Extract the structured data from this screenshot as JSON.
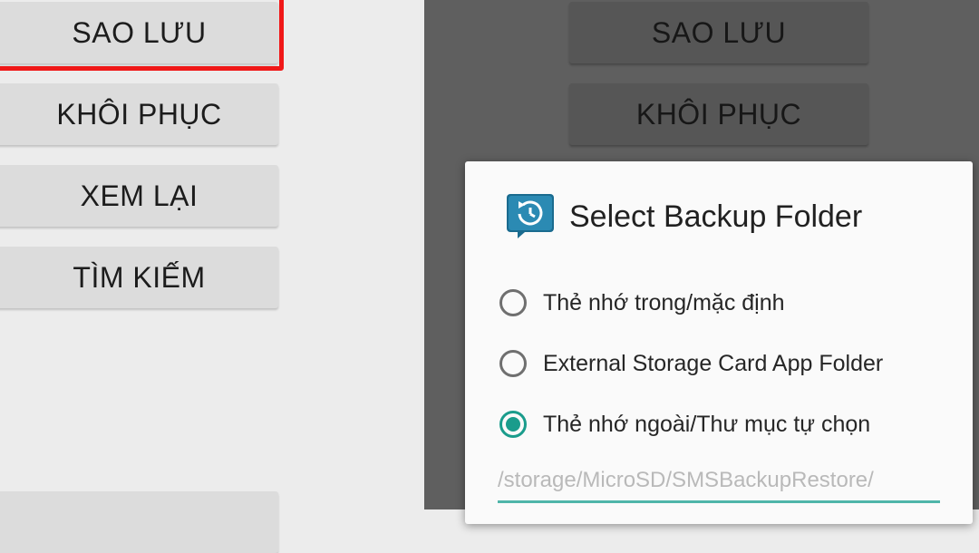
{
  "left_menu": {
    "backup_label": "SAO LƯU",
    "restore_label": "KHÔI PHỤC",
    "view_label": "XEM LẠI",
    "search_label": "TÌM KIẾM"
  },
  "background_menu": {
    "backup_label": "SAO LƯU",
    "restore_label": "KHÔI PHỤC"
  },
  "dialog": {
    "title": "Select Backup Folder",
    "icon": "backup-clock-icon",
    "options": [
      {
        "label": "Thẻ nhớ trong/mặc định",
        "checked": false
      },
      {
        "label": "External Storage Card App Folder",
        "checked": false
      },
      {
        "label": "Thẻ nhớ ngoài/Thư mục tự chọn",
        "checked": true
      }
    ],
    "path_placeholder": "/storage/MicroSD/SMSBackupRestore/"
  },
  "colors": {
    "accent": "#1a9c8c",
    "highlight": "#f01818",
    "overlay": "#5f5f5f"
  }
}
